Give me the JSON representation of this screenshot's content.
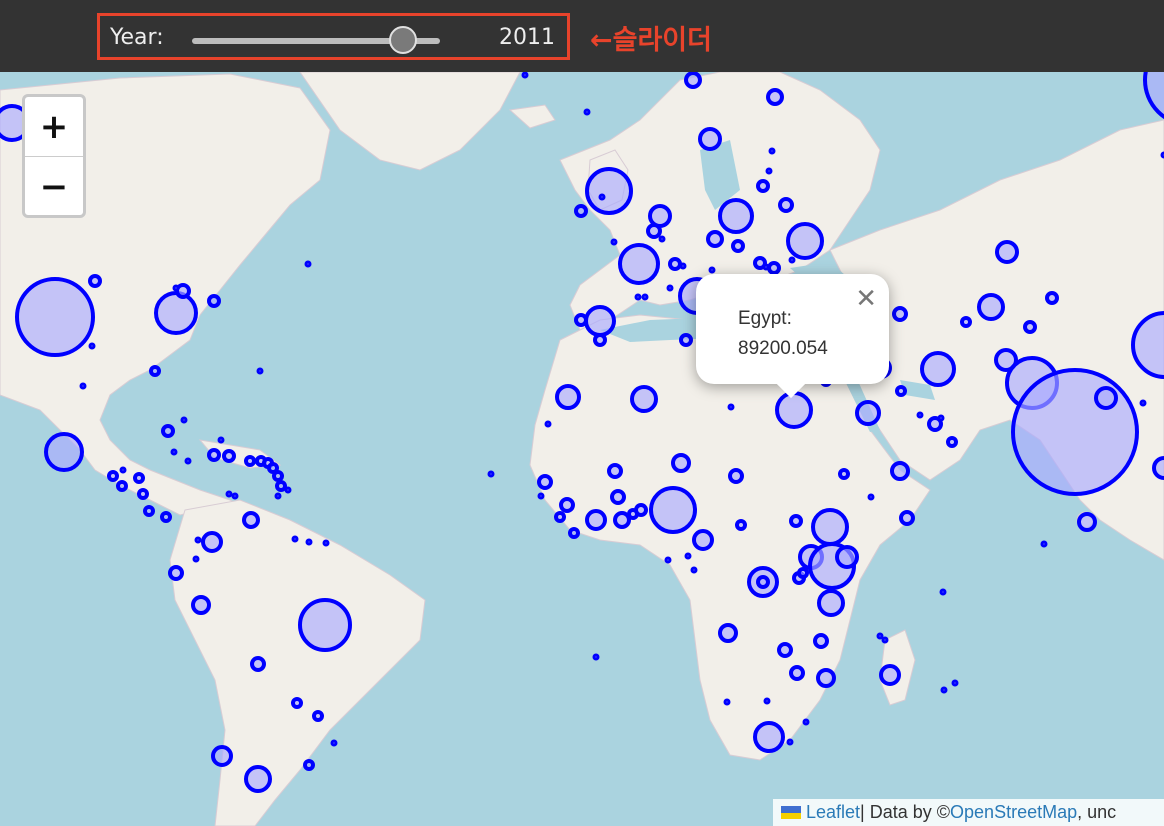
{
  "slider": {
    "label": "Year:",
    "value": "2011",
    "position_fraction": 0.85,
    "annotation": "←슬라이더"
  },
  "zoom": {
    "in_label": "+",
    "out_label": "−"
  },
  "popup": {
    "country": "Egypt:",
    "value": "89200.054",
    "close": "✕"
  },
  "attribution": {
    "leaflet": "Leaflet",
    "sep": " | Data by © ",
    "osm": "OpenStreetMap",
    "tail": ", unc"
  },
  "colors": {
    "ocean": "#aad3df",
    "land": "#f2efe9",
    "marker_stroke": "#0000ff",
    "marker_fill": "#aaaaff",
    "annotation": "#e8432b"
  }
}
